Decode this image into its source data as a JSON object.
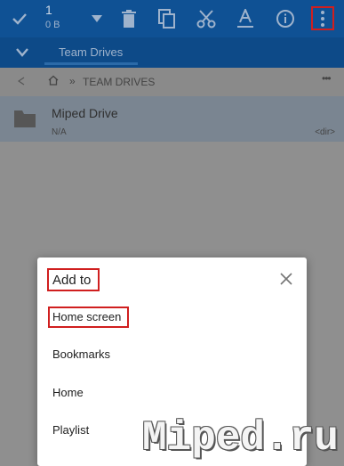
{
  "toolbar": {
    "selection_count": "1",
    "selection_size": "0 B",
    "actions": [
      "check-icon",
      "dropdown-icon",
      "delete-icon",
      "copy-icon",
      "cut-icon",
      "rename-icon",
      "info-icon",
      "more-icon"
    ]
  },
  "tabs": {
    "active_label": "Team Drives"
  },
  "breadcrumb": {
    "separator": "»",
    "path_label": "TEAM DRIVES"
  },
  "list": {
    "items": [
      {
        "name": "Miped Drive",
        "detail": "N/A",
        "type": "<dir>"
      }
    ]
  },
  "dialog": {
    "title": "Add to",
    "options": [
      "Home screen",
      "Bookmarks",
      "Home",
      "Playlist"
    ]
  },
  "watermark": "Miped.ru",
  "colors": {
    "toolbar": "#0f5194",
    "tabbar": "#0d4a88",
    "highlight": "#d01f1f"
  }
}
